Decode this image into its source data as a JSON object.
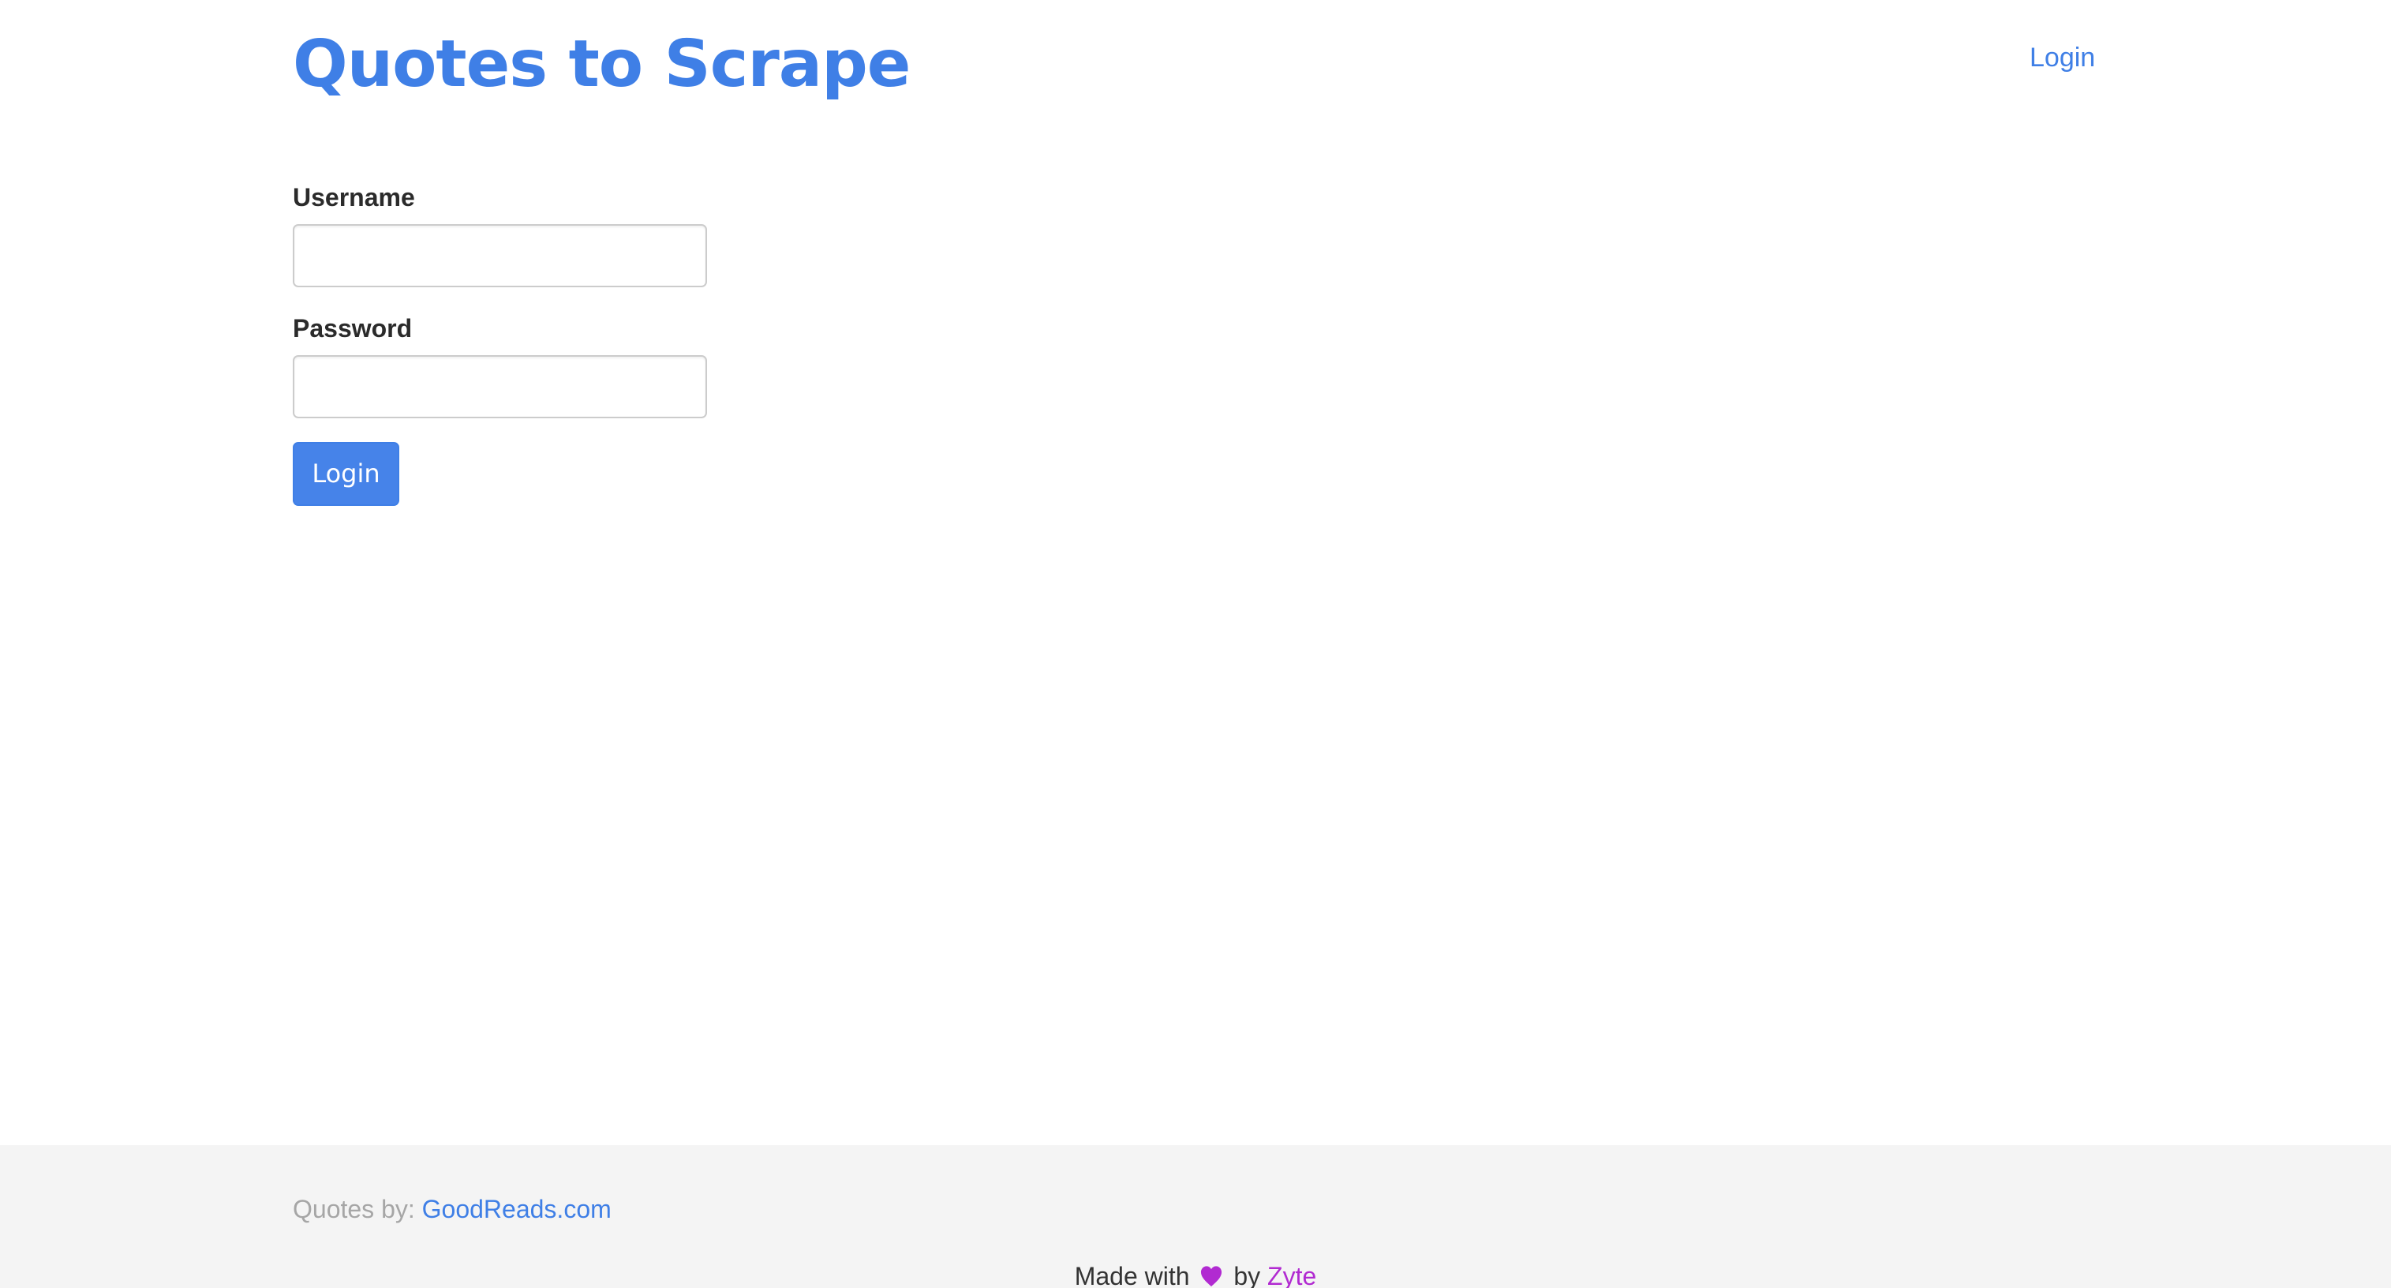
{
  "header": {
    "title": "Quotes to Scrape",
    "login_link": "Login"
  },
  "form": {
    "username_label": "Username",
    "username_value": "",
    "password_label": "Password",
    "password_value": "",
    "submit_label": "Login"
  },
  "footer": {
    "quotes_by_label": "Quotes by:",
    "quotes_by_link": "GoodReads.com",
    "made_with": "Made with",
    "heart_icon": "heart-icon",
    "by_label": "by",
    "maker_link": "Zyte"
  },
  "colors": {
    "accent": "#3f7fe6",
    "button": "#4683e9",
    "heart": "#b12ad1",
    "footer_bg": "#f4f4f4"
  }
}
